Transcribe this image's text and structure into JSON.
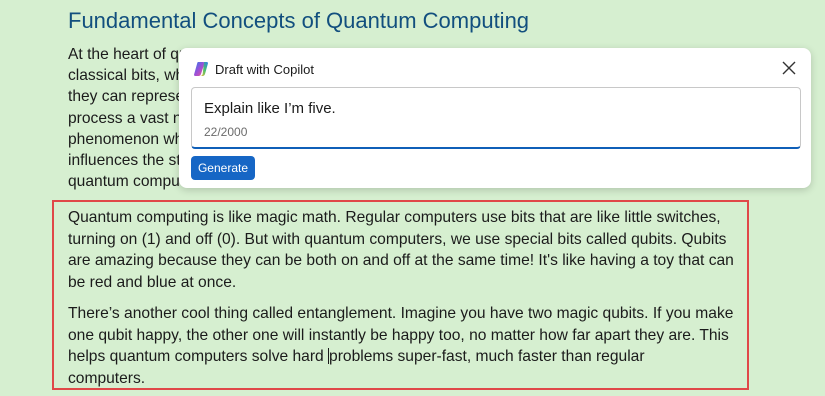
{
  "document": {
    "heading": "Fundamental Concepts of Quantum Computing",
    "background_lines": [
      "At the heart of qu",
      "classical bits, wh",
      "they can represe",
      "process a vast nu",
      "phenomenon wh",
      "influences the st",
      "quantum compu"
    ]
  },
  "copilot": {
    "title": "Draft with Copilot",
    "prompt": "Explain like I’m five.",
    "char_count": "22/2000",
    "generate_label": "Generate"
  },
  "generated": {
    "para1_lines": [
      "Quantum computing is like magic math. Regular computers use bits that are like little switches,",
      "turning on (1) and off (0). But with quantum computers, we use special bits called qubits. Qubits",
      "are amazing because they can be both on and off at the same time! It's like having a toy that can",
      "be red and blue at once."
    ],
    "para2_lines": [
      "There’s another cool thing called entanglement. Imagine you have two magic qubits. If you make",
      "one qubit happy, the other one will instantly be happy too, no matter how far apart they are. This"
    ],
    "para2_line3_before_caret": "helps quantum computers solve hard ",
    "para2_line3_after_caret": "problems super-fast, much faster than regular",
    "para2_line4": "computers."
  },
  "colors": {
    "page_bg": "#d6efd0",
    "heading": "#124f7e",
    "accent": "#1666c5",
    "highlight_border": "#e04848"
  },
  "icons": {
    "copilot": "copilot-logo-icon",
    "close": "close-icon"
  }
}
